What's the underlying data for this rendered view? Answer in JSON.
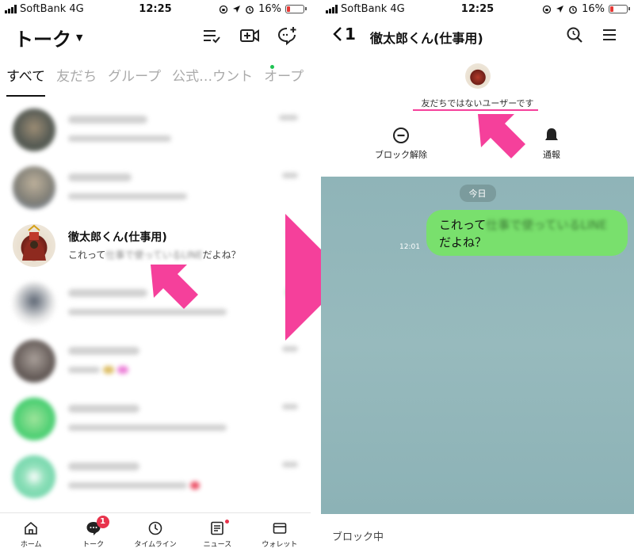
{
  "status": {
    "carrier": "SoftBank",
    "network": "4G",
    "time": "12:25",
    "battery": "16%"
  },
  "talk": {
    "title": "トーク",
    "tabs": [
      "すべて",
      "友だち",
      "グループ",
      "公式…ウント",
      "オープ"
    ],
    "chats": [
      {
        "name": "徹太郎くん(仕事用)",
        "preview_start": "これって",
        "preview_end": "だよね？",
        "preview_hidden": "仕事で使っているLINE"
      }
    ],
    "nav": [
      {
        "label": "ホーム",
        "icon": "home-icon"
      },
      {
        "label": "トーク",
        "icon": "chat-bubble-icon",
        "badge": "1"
      },
      {
        "label": "タイムライン",
        "icon": "clock-icon"
      },
      {
        "label": "ニュース",
        "icon": "news-icon"
      },
      {
        "label": "ウォレット",
        "icon": "wallet-icon"
      }
    ]
  },
  "chat": {
    "back_count": "1",
    "name": "徹太郎くん(仕事用)",
    "not_friend": "友だちではないユーザーです",
    "unblock_label": "ブロック解除",
    "report_label": "通報",
    "date_chip": "今日",
    "message_start": "これって",
    "message_hidden": "仕事で使っているLINE",
    "message_end": "だよね？",
    "message_time": "12:01",
    "blocked_label": "ブロック中"
  },
  "colors": {
    "accent_pink": "#f5409b",
    "bubble_green": "#79e06d",
    "chat_bg": "#97babd",
    "badge_red": "#e8334c"
  }
}
